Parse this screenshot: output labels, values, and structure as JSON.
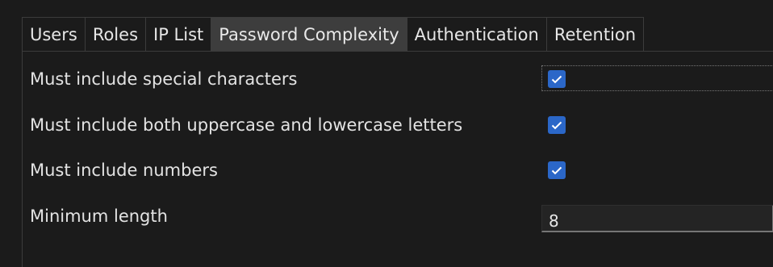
{
  "tabs": [
    {
      "label": "Users",
      "active": false
    },
    {
      "label": "Roles",
      "active": false
    },
    {
      "label": "IP List",
      "active": false
    },
    {
      "label": "Password Complexity",
      "active": true
    },
    {
      "label": "Authentication",
      "active": false
    },
    {
      "label": "Retention",
      "active": false
    }
  ],
  "settings": {
    "special_chars": {
      "label": "Must include special characters",
      "checked": true
    },
    "mixed_case": {
      "label": "Must include both uppercase and lowercase letters",
      "checked": true
    },
    "numbers": {
      "label": "Must include numbers",
      "checked": true
    },
    "min_length": {
      "label": "Minimum length",
      "value": "8"
    }
  },
  "colors": {
    "accent": "#2b67c8",
    "background": "#1b1b1b",
    "active_tab": "#3d3d3d"
  },
  "icons": {
    "checkmark": "checkmark-icon"
  }
}
